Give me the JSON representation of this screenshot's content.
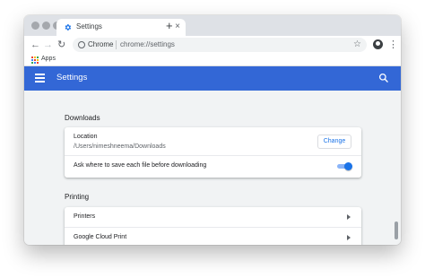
{
  "tab": {
    "title": "Settings",
    "close": "×",
    "icon": "gear-icon"
  },
  "newtab": {
    "label": "+"
  },
  "toolbar": {
    "back": "←",
    "forward": "→",
    "reload": "↻",
    "site_label": "Chrome",
    "url": "chrome://settings",
    "bookmark_star": "☆",
    "menu": "⋮"
  },
  "bookmarks": {
    "apps_label": "Apps"
  },
  "header": {
    "title": "Settings"
  },
  "downloads": {
    "title": "Downloads",
    "location_label": "Location",
    "location_path": "/Users/nimeshneema/Downloads",
    "change_button": "Change",
    "ask_label": "Ask where to save each file before downloading",
    "ask_enabled": true
  },
  "printing": {
    "title": "Printing",
    "items": [
      {
        "label": "Printers"
      },
      {
        "label": "Google Cloud Print"
      }
    ]
  },
  "colors": {
    "header_blue": "#3367d6",
    "accent_blue": "#1a73e8",
    "apps_grid": [
      "#ea4335",
      "#fbbc04",
      "#34a853",
      "#4285f4",
      "#ea4335",
      "#fbbc04",
      "#34a853",
      "#4285f4",
      "#ea4335"
    ]
  }
}
